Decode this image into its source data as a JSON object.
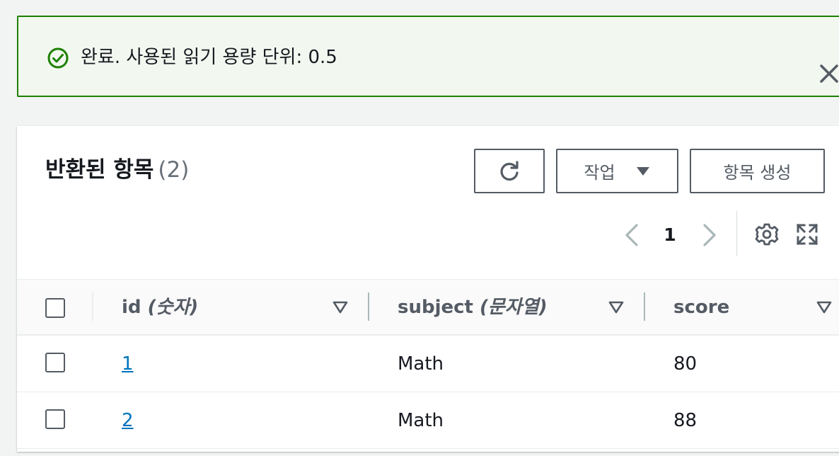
{
  "flash": {
    "message": "완료. 사용된 읽기 용량 단위: 0.5",
    "status_color": "#1d8102",
    "icon": "check-circle-icon",
    "close_icon": "close-icon"
  },
  "panel": {
    "title": "반환된 항목",
    "count": "(2)",
    "buttons": {
      "refresh_icon": "refresh-icon",
      "actions_label": "작업",
      "create_label": "항목 생성"
    },
    "pagination": {
      "current_page": "1"
    }
  },
  "table": {
    "columns": [
      {
        "name": "id",
        "type": "(숫자)"
      },
      {
        "name": "subject",
        "type": "(문자열)"
      },
      {
        "name": "score",
        "type": ""
      }
    ],
    "rows": [
      {
        "id": "1",
        "subject": "Math",
        "score": "80"
      },
      {
        "id": "2",
        "subject": "Math",
        "score": "88"
      }
    ]
  },
  "colors": {
    "link": "#0073bb",
    "success": "#1d8102",
    "text": "#16191f"
  }
}
